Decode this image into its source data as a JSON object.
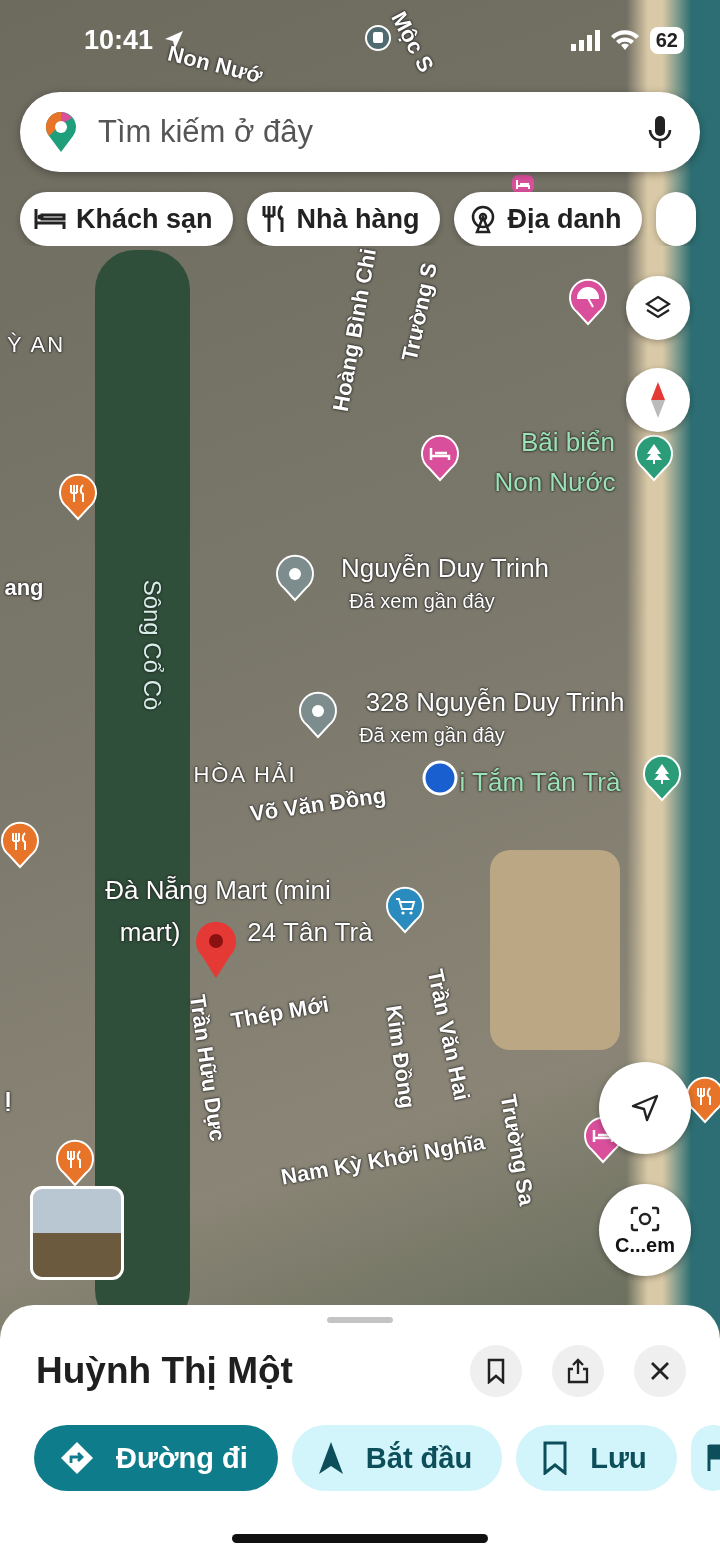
{
  "status_bar": {
    "time": "10:41",
    "battery": "62"
  },
  "search": {
    "placeholder": "Tìm kiếm ở đây"
  },
  "chips": [
    {
      "label": "Khách sạn",
      "kind": "hotel"
    },
    {
      "label": "Nhà hàng",
      "kind": "restaurant"
    },
    {
      "label": "Địa danh",
      "kind": "landmark"
    }
  ],
  "map": {
    "labels": [
      {
        "text": "Non Nướ",
        "kind": "street"
      },
      {
        "text": "Mộc S",
        "kind": "street"
      },
      {
        "text": "Hoàng Bình Chi",
        "kind": "street"
      },
      {
        "text": "Trường S",
        "kind": "street"
      },
      {
        "text": "Ỳ AN",
        "kind": "area"
      },
      {
        "text": "ang",
        "kind": "street"
      },
      {
        "text": "Bãi biển",
        "kind": "park"
      },
      {
        "text": "Non Nước",
        "kind": "park"
      },
      {
        "text": "Sông Cổ Cò",
        "kind": "water"
      },
      {
        "text": "Nguyễn Duy Trinh",
        "kind": "place"
      },
      {
        "text": "Đã xem gần đây",
        "kind": "recent"
      },
      {
        "text": "328 Nguyễn Duy Trinh",
        "kind": "place"
      },
      {
        "text": "Đã xem gần đây",
        "kind": "recent"
      },
      {
        "text": "HÒA HẢI",
        "kind": "area"
      },
      {
        "text": "i Tắm Tân Trà",
        "kind": "park"
      },
      {
        "text": "Võ Văn Đồng",
        "kind": "street"
      },
      {
        "text": "Đà Nẵng Mart (mini",
        "kind": "place"
      },
      {
        "text": "mart)",
        "kind": "place"
      },
      {
        "text": "24 Tân Trà",
        "kind": "place"
      },
      {
        "text": "Thép Mới",
        "kind": "street"
      },
      {
        "text": "Trần Hữu Dực",
        "kind": "street"
      },
      {
        "text": "Kim Đồng",
        "kind": "street"
      },
      {
        "text": "Trần Văn Hai",
        "kind": "street"
      },
      {
        "text": "Trường Sa",
        "kind": "street"
      },
      {
        "text": "Nam Kỳ Khởi Nghĩa",
        "kind": "street"
      },
      {
        "text": "Ị",
        "kind": "street"
      }
    ],
    "camera_button": {
      "label": "C...em"
    }
  },
  "sheet": {
    "title": "Huỳnh Thị Một",
    "actions": [
      {
        "label": "Đường đi",
        "kind": "primary"
      },
      {
        "label": "Bắt đầu",
        "kind": "start"
      },
      {
        "label": "Lưu",
        "kind": "save"
      }
    ]
  }
}
